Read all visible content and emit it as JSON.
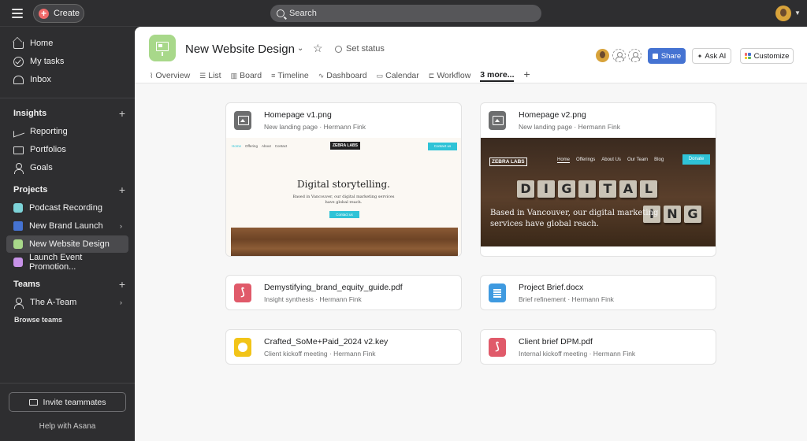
{
  "topbar": {
    "create_label": "Create",
    "search_placeholder": "Search"
  },
  "sidebar": {
    "main_items": [
      {
        "label": "Home",
        "icon": "home-icon"
      },
      {
        "label": "My tasks",
        "icon": "check-circle-icon"
      },
      {
        "label": "Inbox",
        "icon": "bell-icon"
      }
    ],
    "insights": {
      "title": "Insights",
      "items": [
        {
          "label": "Reporting",
          "icon": "chart-icon"
        },
        {
          "label": "Portfolios",
          "icon": "folder-icon"
        },
        {
          "label": "Goals",
          "icon": "person-icon"
        }
      ]
    },
    "projects": {
      "title": "Projects",
      "items": [
        {
          "label": "Podcast Recording",
          "color": "#7dd3d8"
        },
        {
          "label": "New Brand Launch",
          "color": "#4573d2"
        },
        {
          "label": "New Website Design",
          "color": "#a8d88a"
        },
        {
          "label": "Launch Event Promotion...",
          "color": "#c792e8"
        }
      ]
    },
    "teams": {
      "title": "Teams",
      "items": [
        {
          "label": "The A-Team",
          "icon": "team-icon"
        }
      ],
      "browse_label": "Browse teams"
    },
    "invite_label": "Invite teammates",
    "help_label": "Help with Asana"
  },
  "header": {
    "title": "New Website Design",
    "set_status_label": "Set status",
    "share_label": "Share",
    "ask_ai_label": "Ask AI",
    "customize_label": "Customize",
    "tabs": [
      {
        "label": "Overview",
        "icon": "overview-icon"
      },
      {
        "label": "List",
        "icon": "list-icon"
      },
      {
        "label": "Board",
        "icon": "board-icon"
      },
      {
        "label": "Timeline",
        "icon": "timeline-icon"
      },
      {
        "label": "Dashboard",
        "icon": "dashboard-icon"
      },
      {
        "label": "Calendar",
        "icon": "calendar-icon"
      },
      {
        "label": "Workflow",
        "icon": "workflow-icon"
      },
      {
        "label": "3 more...",
        "icon": ""
      }
    ]
  },
  "files": {
    "hp1": {
      "title": "Homepage v1.png",
      "subtitle": "New landing page · Hermann Fink"
    },
    "hp2": {
      "title": "Homepage v2.png",
      "subtitle": "New landing page · Hermann Fink"
    },
    "pdf1": {
      "title": "Demystifying_brand_equity_guide.pdf",
      "subtitle": "Insight synthesis · Hermann Fink"
    },
    "doc1": {
      "title": "Project Brief.docx",
      "subtitle": "Brief refinement · Hermann Fink"
    },
    "key1": {
      "title": "Crafted_SoMe+Paid_2024 v2.key",
      "subtitle": "Client kickoff meeting · Hermann Fink"
    },
    "pdf2": {
      "title": "Client brief DPM.pdf",
      "subtitle": "Internal kickoff meeting · Hermann Fink"
    }
  },
  "preview_v1": {
    "nav": [
      "Home",
      "Offering",
      "About",
      "Contact"
    ],
    "logo": "ZEBRA LABS",
    "contact_btn": "Contact us",
    "headline": "Digital storytelling.",
    "body_line1": "Based in Vancouver, our digital marketing services",
    "body_line2": "have global reach.",
    "cta": "Contact us"
  },
  "preview_v2": {
    "logo": "ZEBRA LABS",
    "nav": [
      "Home",
      "Offerings",
      "About Us",
      "Our Team",
      "Blog"
    ],
    "donate": "Donate",
    "tiles_row1": [
      "D",
      "I",
      "G",
      "I",
      "T",
      "A",
      "L"
    ],
    "tiles_row2": [
      "I",
      "N",
      "G"
    ],
    "text": "Based in Vancouver, our digital marketing services have global reach."
  }
}
